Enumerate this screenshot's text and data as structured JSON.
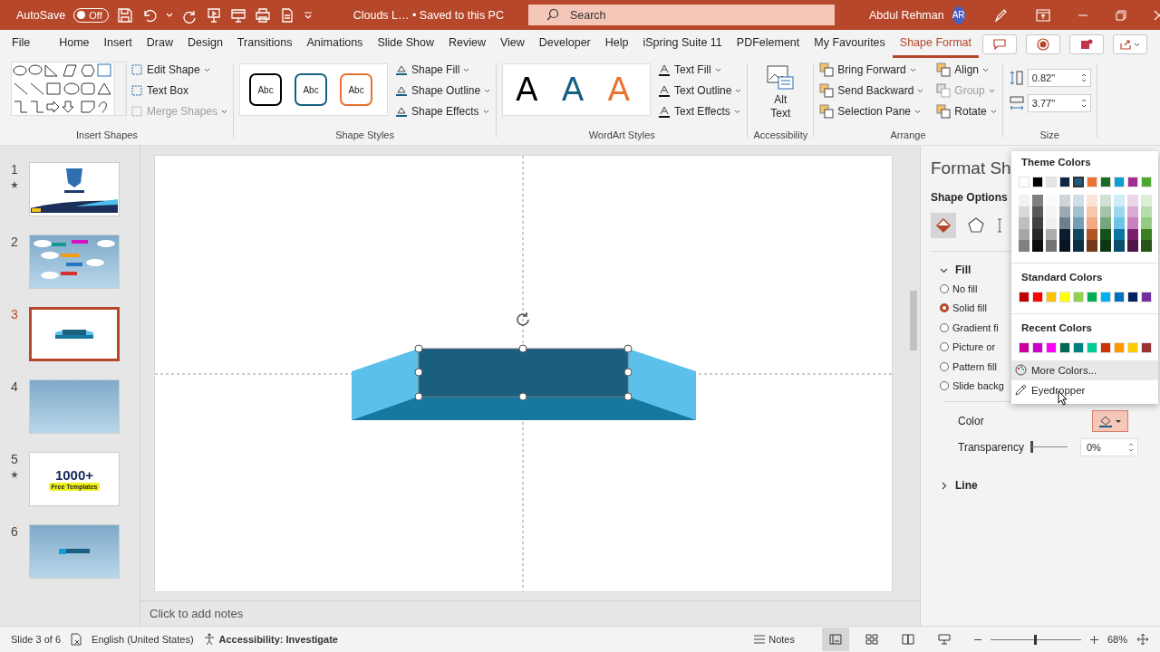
{
  "title_bar": {
    "autosave_label": "AutoSave",
    "autosave_toggle": {
      "label": "Off",
      "on": false
    },
    "document_title": "Clouds L… • Saved to this PC",
    "search_placeholder": "Search",
    "user_name": "Abdul Rehman",
    "avatar_initials": "AR"
  },
  "tabs": [
    {
      "label": "File",
      "selected": false
    },
    {
      "label": "Home",
      "selected": false
    },
    {
      "label": "Insert",
      "selected": false
    },
    {
      "label": "Draw",
      "selected": false
    },
    {
      "label": "Design",
      "selected": false
    },
    {
      "label": "Transitions",
      "selected": false
    },
    {
      "label": "Animations",
      "selected": false
    },
    {
      "label": "Slide Show",
      "selected": false
    },
    {
      "label": "Review",
      "selected": false
    },
    {
      "label": "View",
      "selected": false
    },
    {
      "label": "Developer",
      "selected": false
    },
    {
      "label": "Help",
      "selected": false
    },
    {
      "label": "iSpring Suite 11",
      "selected": false
    },
    {
      "label": "PDFelement",
      "selected": false
    },
    {
      "label": "My Favourites",
      "selected": false
    },
    {
      "label": "Shape Format",
      "selected": true
    }
  ],
  "ribbon": {
    "insert_shapes": {
      "label": "Insert Shapes",
      "commands": [
        {
          "label": "Edit Shape",
          "dropdown": true,
          "disabled": false
        },
        {
          "label": "Text Box",
          "dropdown": false,
          "disabled": false
        },
        {
          "label": "Merge Shapes",
          "dropdown": true,
          "disabled": true
        }
      ]
    },
    "shape_styles": {
      "label": "Shape Styles",
      "samples": [
        {
          "text": "Abc",
          "color": "#000000"
        },
        {
          "text": "Abc",
          "color": "#156082"
        },
        {
          "text": "Abc",
          "color": "#e97132"
        }
      ],
      "commands": [
        {
          "label": "Shape Fill"
        },
        {
          "label": "Shape Outline"
        },
        {
          "label": "Shape Effects"
        }
      ]
    },
    "wordart_styles": {
      "label": "WordArt Styles",
      "samples": [
        {
          "text": "A",
          "color": "#000000"
        },
        {
          "text": "A",
          "color": "#156082"
        },
        {
          "text": "A",
          "color": "#e97132"
        }
      ],
      "commands": [
        {
          "label": "Text Fill"
        },
        {
          "label": "Text Outline"
        },
        {
          "label": "Text Effects"
        }
      ]
    },
    "accessibility": {
      "label": "Accessibility",
      "button": "Alt Text"
    },
    "arrange": {
      "label": "Arrange",
      "commands": [
        {
          "label": "Bring Forward",
          "disabled": false
        },
        {
          "label": "Send Backward",
          "disabled": false
        },
        {
          "label": "Selection Pane",
          "disabled": false
        },
        {
          "label": "Align",
          "disabled": false
        },
        {
          "label": "Group",
          "disabled": true
        },
        {
          "label": "Rotate",
          "disabled": false
        }
      ]
    },
    "size": {
      "label": "Size",
      "height": "0.82\"",
      "width": "3.77\""
    }
  },
  "slides": [
    {
      "number": "1",
      "starred": true,
      "selected": false,
      "kind": "title"
    },
    {
      "number": "2",
      "starred": false,
      "selected": false,
      "kind": "diagram"
    },
    {
      "number": "3",
      "starred": false,
      "selected": true,
      "kind": "shape"
    },
    {
      "number": "4",
      "starred": false,
      "selected": false,
      "kind": "blank"
    },
    {
      "number": "5",
      "starred": true,
      "selected": false,
      "kind": "promo",
      "headline": "1000+",
      "tagline": "Free Templates"
    },
    {
      "number": "6",
      "starred": false,
      "selected": false,
      "kind": "bar"
    }
  ],
  "notes_placeholder": "Click to add notes",
  "format_pane": {
    "title": "Format Sh",
    "options_label": "Shape Options",
    "fill": {
      "label": "Fill",
      "expanded": true,
      "options": [
        {
          "label": "No fill",
          "selected": false
        },
        {
          "label": "Solid fill",
          "selected": true
        },
        {
          "label": "Gradient fi",
          "selected": false
        },
        {
          "label": "Picture or",
          "selected": false
        },
        {
          "label": "Pattern fill",
          "selected": false
        },
        {
          "label": "Slide backg",
          "selected": false
        }
      ],
      "color_label": "Color",
      "transparency": {
        "label": "Transparency",
        "value": "0%",
        "level": 0
      }
    },
    "line": {
      "label": "Line",
      "expanded": false
    }
  },
  "color_menu": {
    "theme_title": "Theme Colors",
    "theme_colors": [
      {
        "color": "#ffffff",
        "selected": false
      },
      {
        "color": "#000000",
        "selected": false
      },
      {
        "color": "#e7e6e6",
        "selected": false
      },
      {
        "color": "#0e2841",
        "selected": false
      },
      {
        "color": "#156082",
        "selected": true
      },
      {
        "color": "#e97132",
        "selected": false
      },
      {
        "color": "#196b24",
        "selected": false
      },
      {
        "color": "#0f9ed5",
        "selected": false
      },
      {
        "color": "#a02b93",
        "selected": false
      },
      {
        "color": "#4ea72e",
        "selected": false
      }
    ],
    "standard_title": "Standard Colors",
    "standard_colors": [
      {
        "color": "#c00000"
      },
      {
        "color": "#ff0000"
      },
      {
        "color": "#ffc000"
      },
      {
        "color": "#ffff00"
      },
      {
        "color": "#92d050"
      },
      {
        "color": "#00b050"
      },
      {
        "color": "#00b0f0"
      },
      {
        "color": "#0070c0"
      },
      {
        "color": "#002060"
      },
      {
        "color": "#7030a0"
      }
    ],
    "recent_title": "Recent Colors",
    "recent_colors": [
      {
        "color": "#cc0099"
      },
      {
        "color": "#cc00cc"
      },
      {
        "color": "#ff00ff"
      },
      {
        "color": "#006655"
      },
      {
        "color": "#008080"
      },
      {
        "color": "#00cc99"
      },
      {
        "color": "#cc3300"
      },
      {
        "color": "#ff9900"
      },
      {
        "color": "#ffcc00"
      },
      {
        "color": "#993333"
      }
    ],
    "more_colors": "More Colors...",
    "eyedropper": "Eyedropper"
  },
  "status_bar": {
    "slide_info": "Slide 3 of 6",
    "language": "English (United States)",
    "accessibility": "Accessibility: Investigate",
    "notes": "Notes",
    "zoom": {
      "value": "68%",
      "level": 0.5
    }
  }
}
